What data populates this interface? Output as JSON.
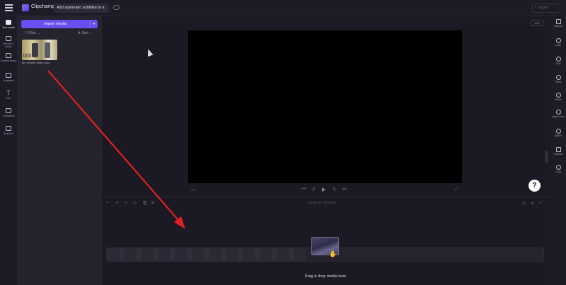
{
  "topbar": {
    "brand": "Clipchamp",
    "project_title": "Add automatic subtitles to a",
    "export_label": "Export"
  },
  "leftnav": {
    "items": [
      {
        "label": "Your media",
        "icon": "folder-icon"
      },
      {
        "label": "Record & create",
        "icon": "camera-icon"
      },
      {
        "label": "Content library",
        "icon": "library-icon"
      },
      {
        "label": "Templates",
        "icon": "templates-icon"
      },
      {
        "label": "Text",
        "icon": "text-icon"
      },
      {
        "label": "Transitions",
        "icon": "transitions-icon"
      },
      {
        "label": "Brand kit",
        "icon": "brand-kit-icon"
      }
    ]
  },
  "media": {
    "import_label": "Import media",
    "filter_label": "Filter",
    "sort_label": "Sort",
    "clip_duration": "0:20",
    "clip_name": "My GRWM video.mp4"
  },
  "preview": {
    "aspect_ratio": "16:9"
  },
  "rightpanel": {
    "items": [
      {
        "label": "Captions",
        "icon": "captions-icon"
      },
      {
        "label": "Audio",
        "icon": "audio-icon"
      },
      {
        "label": "Fade",
        "icon": "fade-icon"
      },
      {
        "label": "Filters",
        "icon": "filters-icon"
      },
      {
        "label": "Effects",
        "icon": "effects-icon"
      },
      {
        "label": "Adjust colors",
        "icon": "adjust-colors-icon"
      },
      {
        "label": "Speed",
        "icon": "speed-icon"
      },
      {
        "label": "Transition",
        "icon": "transition-icon"
      },
      {
        "label": "Color",
        "icon": "color-icon"
      }
    ]
  },
  "help": {
    "label": "?"
  },
  "timeline": {
    "timecode": "00:00.00 / 00:20.00",
    "drop_hint": "Drag & drop media here"
  },
  "colors": {
    "accent": "#6b4ef0",
    "annotation_arrow": "#e02020",
    "background": "#1b1a24"
  }
}
